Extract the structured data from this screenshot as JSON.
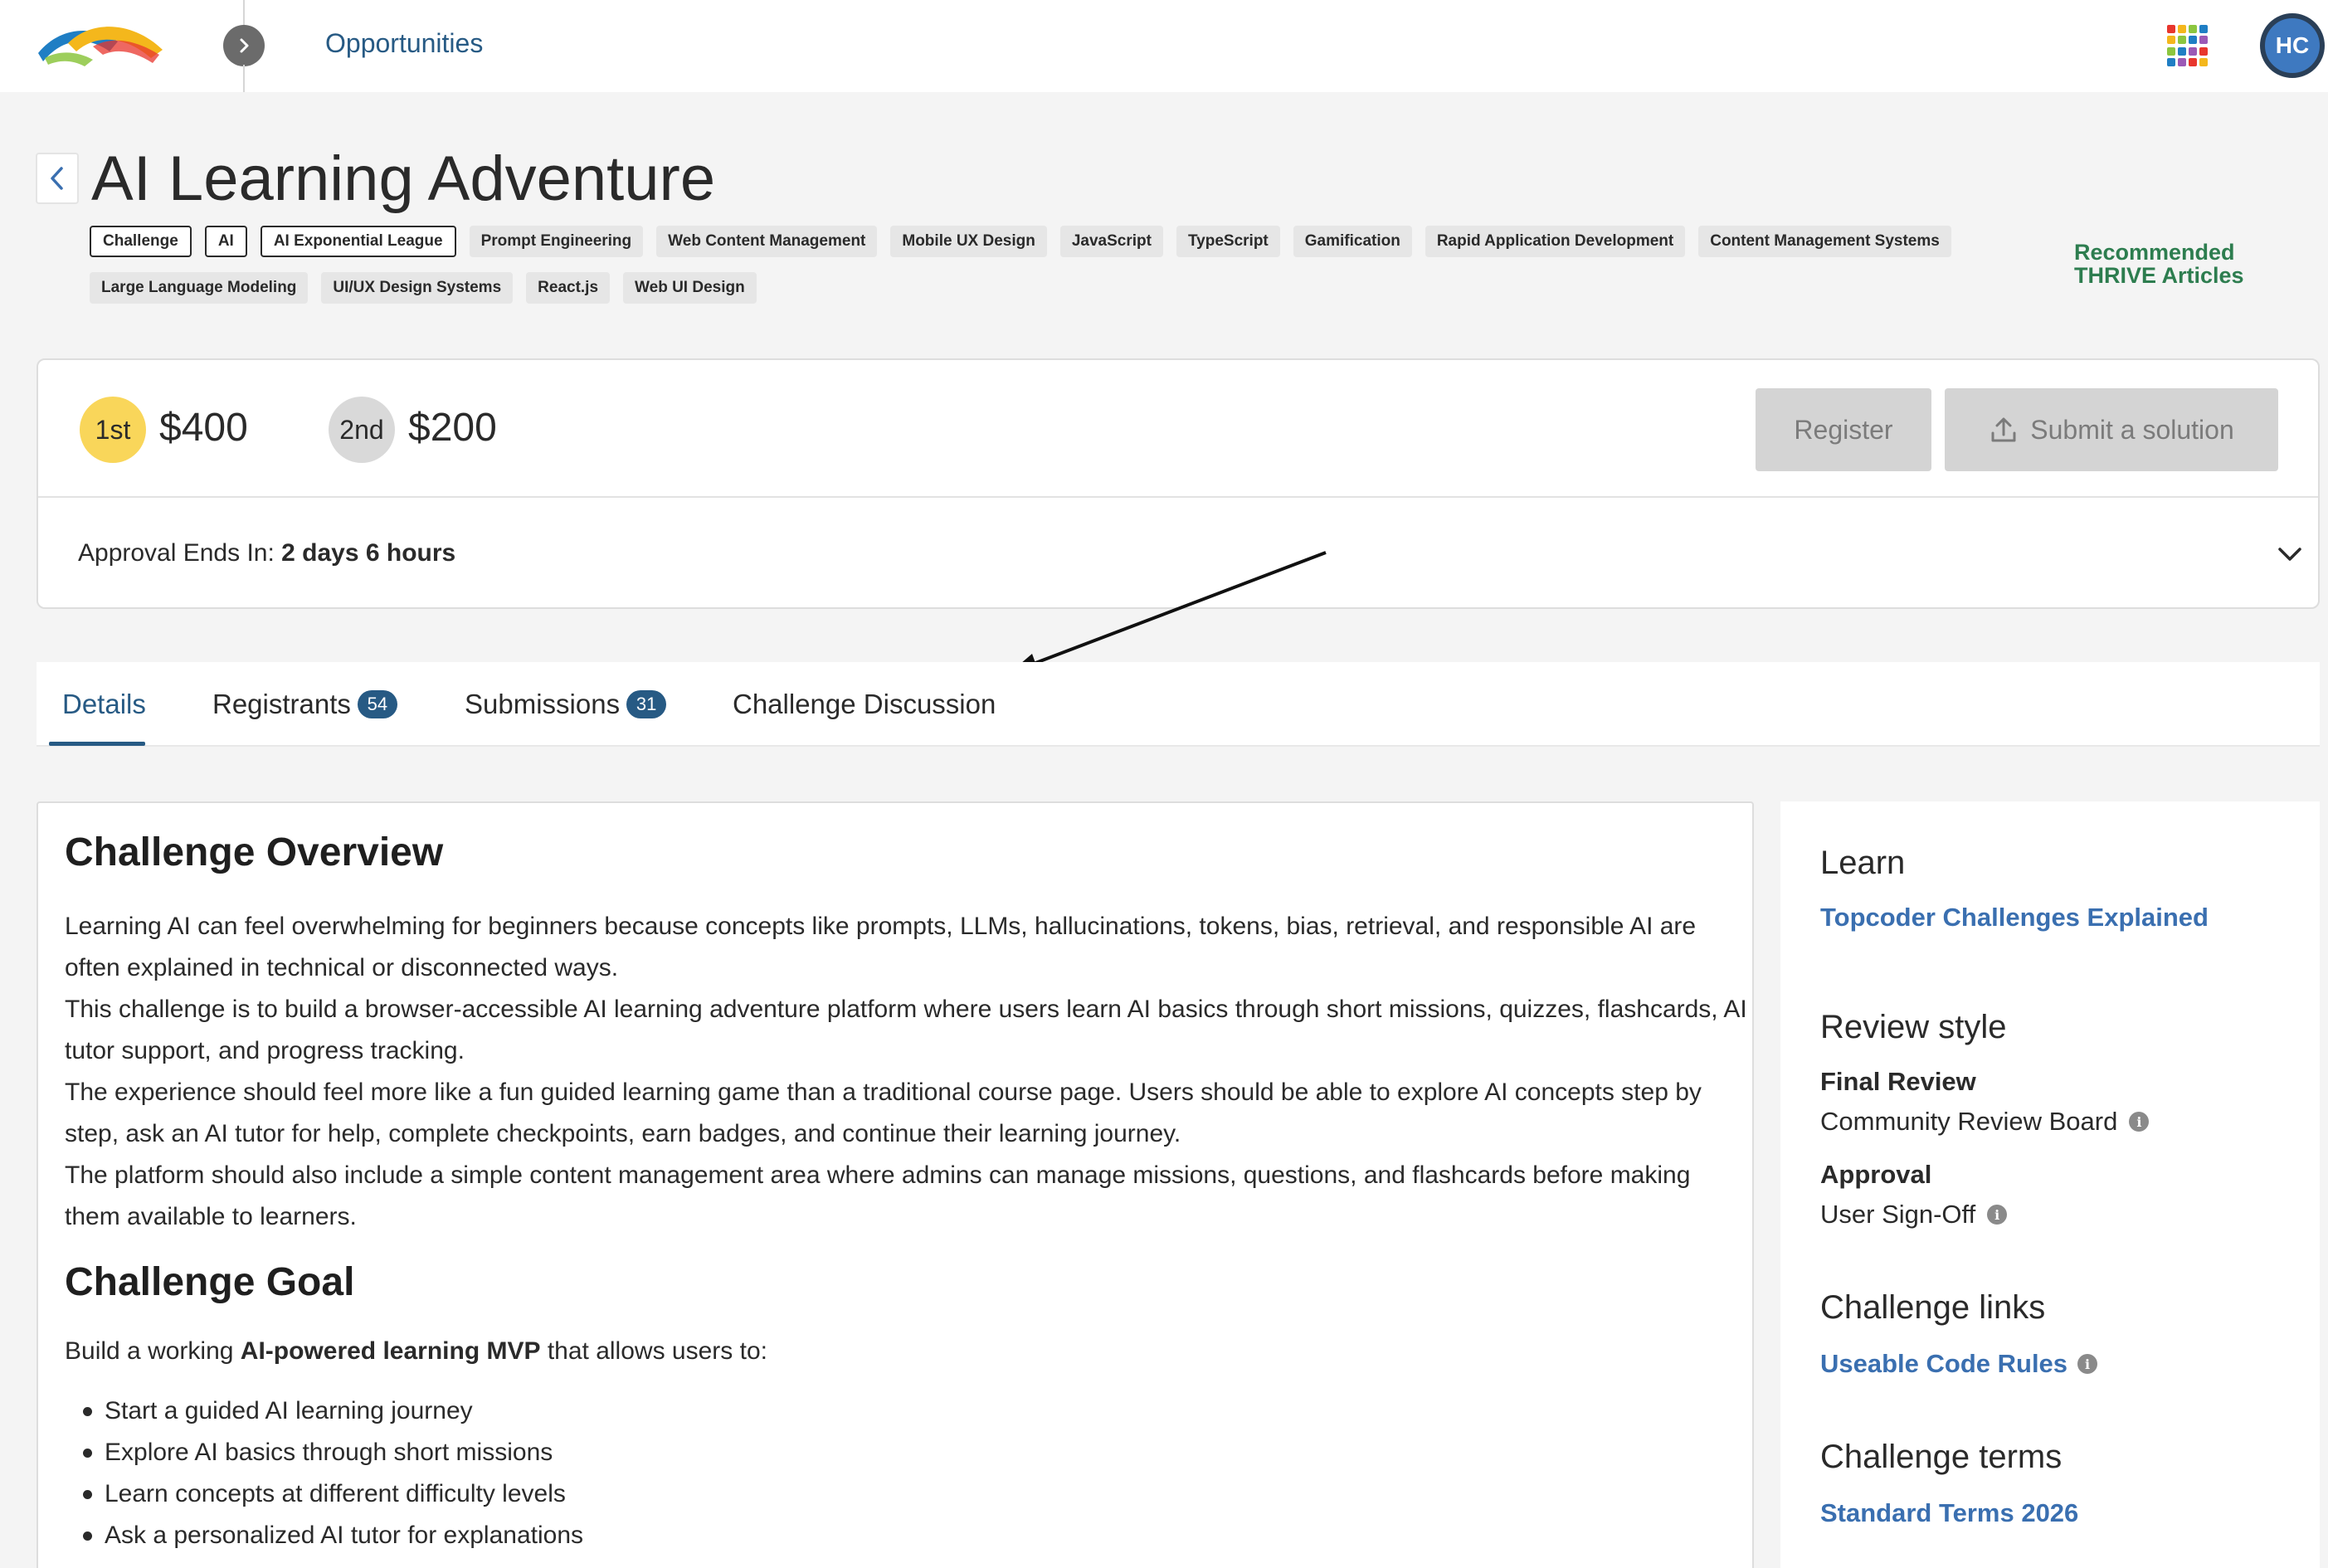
{
  "topbar": {
    "nav_title": "Opportunities",
    "avatar_initials": "HC",
    "logo_colors": [
      "#1f7ec4",
      "#f4b71c",
      "#e8362d",
      "#8cc63f"
    ],
    "apps_colors": [
      "#e8362d",
      "#f4b71c",
      "#8cc63f",
      "#1f7ec4",
      "#f4b71c",
      "#8cc63f",
      "#1f7ec4",
      "#9b59b6",
      "#8cc63f",
      "#1f7ec4",
      "#9b59b6",
      "#e8362d",
      "#1f7ec4",
      "#9b59b6",
      "#e8362d",
      "#f4b71c"
    ]
  },
  "header": {
    "title": "AI Learning Adventure",
    "tags": [
      {
        "label": "Challenge",
        "outlined": true
      },
      {
        "label": "AI",
        "outlined": true
      },
      {
        "label": "AI Exponential League",
        "outlined": true
      },
      {
        "label": "Prompt Engineering",
        "outlined": false
      },
      {
        "label": "Web Content Management",
        "outlined": false
      },
      {
        "label": "Mobile UX Design",
        "outlined": false
      },
      {
        "label": "JavaScript",
        "outlined": false
      },
      {
        "label": "TypeScript",
        "outlined": false
      },
      {
        "label": "Gamification",
        "outlined": false
      },
      {
        "label": "Rapid Application Development",
        "outlined": false
      },
      {
        "label": "Content Management Systems",
        "outlined": false
      },
      {
        "label": "Large Language Modeling",
        "outlined": false
      },
      {
        "label": "UI/UX Design Systems",
        "outlined": false
      },
      {
        "label": "React.js",
        "outlined": false
      },
      {
        "label": "Web UI Design",
        "outlined": false
      }
    ],
    "thrive_link": "Recommended THRIVE Articles"
  },
  "prizes": {
    "first_place": "1st",
    "first_amount": "$400",
    "second_place": "2nd",
    "second_amount": "$200",
    "register_label": "Register",
    "submit_label": "Submit a solution",
    "approval_label": "Approval Ends In: ",
    "approval_value": "2 days 6 hours"
  },
  "tabs": {
    "details": "Details",
    "registrants": "Registrants",
    "registrants_count": "54",
    "submissions": "Submissions",
    "submissions_count": "31",
    "discussion": "Challenge Discussion"
  },
  "content": {
    "overview_heading": "Challenge Overview",
    "overview_paragraphs": [
      "Learning AI can feel overwhelming for beginners because concepts like prompts, LLMs, hallucinations, tokens, bias, retrieval, and responsible AI are often explained in technical or disconnected ways.",
      "This challenge is to build a browser-accessible AI learning adventure platform where users learn AI basics through short missions, quizzes, flashcards, AI tutor support, and progress tracking.",
      "The experience should feel more like a fun guided learning game than a traditional course page. Users should be able to explore AI concepts step by step, ask an AI tutor for help, complete checkpoints, earn badges, and continue their learning journey.",
      "The platform should also include a simple content management area where admins can manage missions, questions, and flashcards before making them available to learners."
    ],
    "goal_heading": "Challenge Goal",
    "goal_intro_pre": "Build a working ",
    "goal_intro_bold": "AI-powered learning MVP",
    "goal_intro_post": " that allows users to:",
    "goal_items": [
      "Start a guided AI learning journey",
      "Explore AI basics through short missions",
      "Learn concepts at different difficulty levels",
      "Ask a personalized AI tutor for explanations"
    ]
  },
  "sidebar": {
    "learn_heading": "Learn",
    "learn_link": "Topcoder Challenges Explained",
    "review_heading": "Review style",
    "final_review_label": "Final Review",
    "final_review_value": "Community Review Board",
    "approval_label": "Approval",
    "approval_value": "User Sign-Off",
    "links_heading": "Challenge links",
    "links_item": "Useable Code Rules",
    "terms_heading": "Challenge terms",
    "terms_item": "Standard Terms 2026"
  }
}
